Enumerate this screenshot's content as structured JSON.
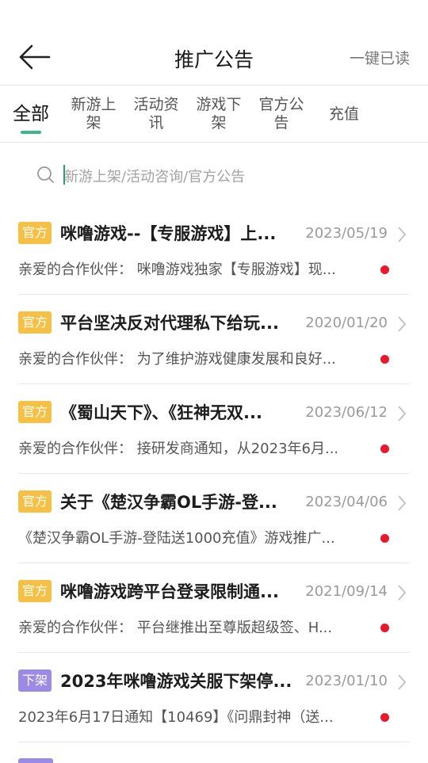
{
  "header": {
    "title": "推广公告",
    "read_all": "一键已读",
    "back_icon": "arrow-left-icon"
  },
  "tabs": [
    {
      "line1": "全部",
      "line2": "",
      "active": true
    },
    {
      "line1": "新游上",
      "line2": "架",
      "active": false
    },
    {
      "line1": "活动资",
      "line2": "讯",
      "active": false
    },
    {
      "line1": "游戏下",
      "line2": "架",
      "active": false
    },
    {
      "line1": "官方公",
      "line2": "告",
      "active": false
    },
    {
      "line1": "充值",
      "line2": "",
      "active": false
    }
  ],
  "colors": {
    "accent": "#3bb58a",
    "tag_official": "#f5c043",
    "tag_offline": "#9c8be6",
    "unread_dot": "#e8192c"
  },
  "search": {
    "placeholder": "新游上架/活动咨询/官方公告",
    "icon": "search-icon"
  },
  "announcements": [
    {
      "tag": "官方",
      "title": "咪噜游戏--【专服游戏】上...",
      "date": "2023/05/19",
      "summary": "亲爱的合作伙伴： 咪噜游戏独家【专服游戏】现...",
      "unread": true
    },
    {
      "tag": "官方",
      "title": "平台坚决反对代理私下给玩...",
      "date": "2020/01/20",
      "summary": "亲爱的合作伙伴： 为了维护游戏健康发展和良好...",
      "unread": true
    },
    {
      "tag": "官方",
      "title": "《蜀山天下》、《狂神无双...",
      "date": "2023/06/12",
      "summary": "亲爱的合作伙伴： 接研发商通知，从2023年6月...",
      "unread": true
    },
    {
      "tag": "官方",
      "title": "关于《楚汉争霸OL手游-登...",
      "date": "2023/04/06",
      "summary": "《楚汉争霸OL手游-登陆送1000充值》游戏推广...",
      "unread": true
    },
    {
      "tag": "官方",
      "title": "咪噜游戏跨平台登录限制通...",
      "date": "2021/09/14",
      "summary": "亲爱的合作伙伴： 平台继推出至尊版超级签、H...",
      "unread": true
    },
    {
      "tag": "下架",
      "title": "2023年咪噜游戏关服下架停...",
      "date": "2023/01/10",
      "summary": "2023年6月17日通知【10469】《问鼎封神（送...",
      "unread": true
    }
  ]
}
